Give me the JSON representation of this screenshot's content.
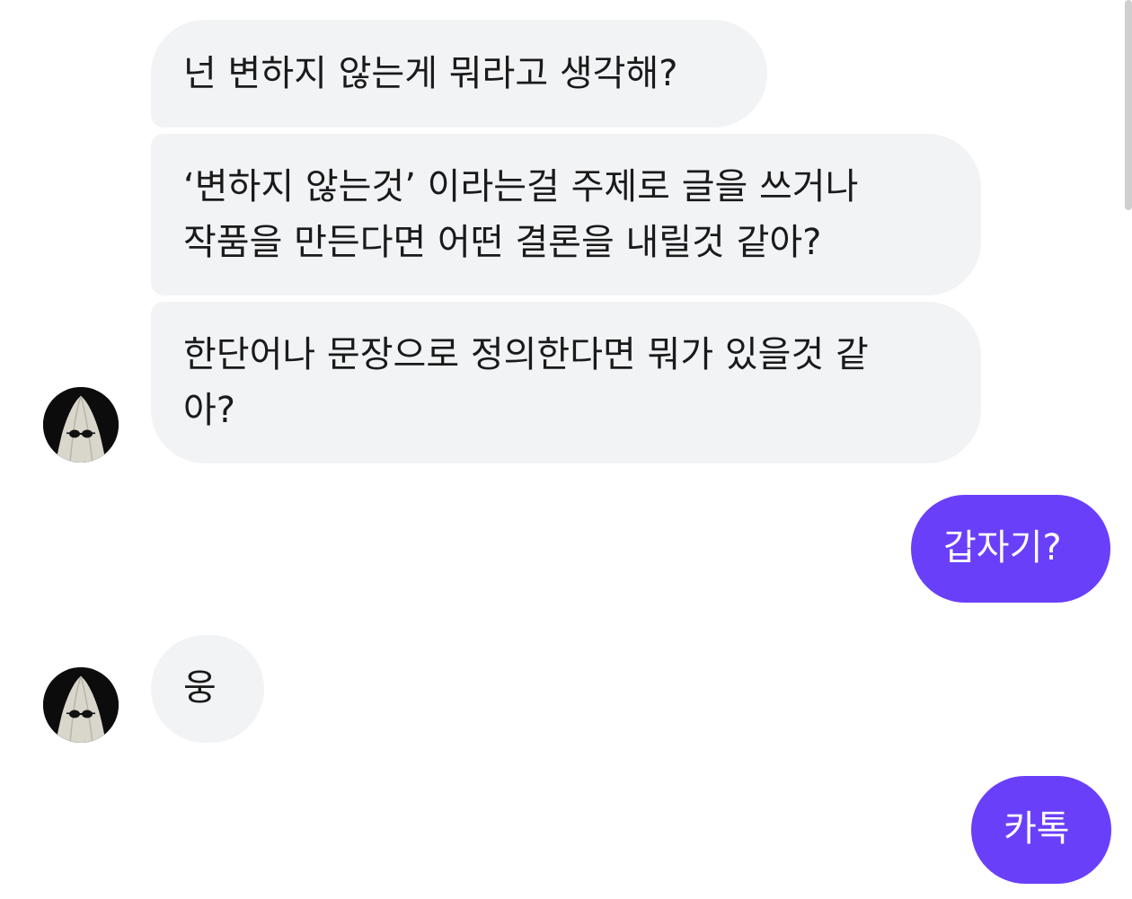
{
  "messages": [
    {
      "sender": "other",
      "lines": [
        "넌 변하지 않는게 뭐라고 생각해?"
      ]
    },
    {
      "sender": "other",
      "lines": [
        "‘변하지 않는것’ 이라는걸 주제로 글을 쓰거나",
        "작품을 만든다면 어떤 결론을 내릴것 같아?"
      ]
    },
    {
      "sender": "other",
      "lines": [
        "한단어나 문장으로 정의한다면 뭐가 있을것 같",
        "아?"
      ]
    },
    {
      "sender": "me",
      "lines": [
        "갑자기?"
      ]
    },
    {
      "sender": "other",
      "lines": [
        "웅"
      ]
    },
    {
      "sender": "me",
      "lines": [
        "카톡"
      ]
    }
  ],
  "colors": {
    "incoming_bubble": "#f2f3f5",
    "outgoing_bubble": "#6a3ffa",
    "outgoing_text": "#ffffff",
    "incoming_text": "#1a1a1a"
  },
  "icons": {
    "avatar": "ghost-with-sunglasses-avatar"
  }
}
